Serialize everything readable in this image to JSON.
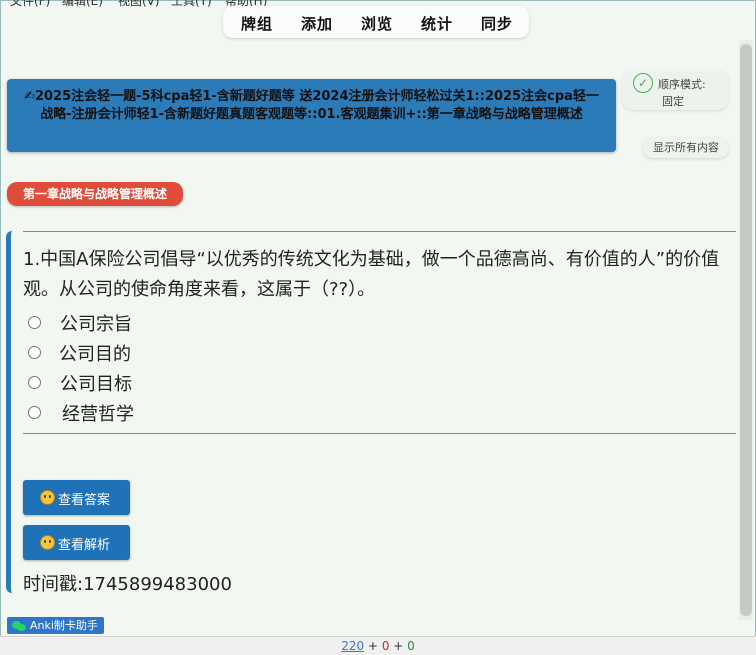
{
  "menubar": [
    "文件(F)",
    "编辑(E)",
    "视图(V)",
    "工具(T)",
    "帮助(H)"
  ],
  "toolbar": {
    "items": [
      "牌组",
      "添加",
      "浏览",
      "统计",
      "同步"
    ]
  },
  "deck": {
    "title": "✍2025注会轻一题-5科cpa轻1-含新题好题等 送2024注册会计师轻松过关1::2025注会cpa轻一战略-注册会计师轻1-含新题好题真题客观题等::01.客观题集训+::第一章战略与战略管理概述"
  },
  "order_mode": {
    "icon": "check-circle-icon",
    "label": "顺序模式:",
    "value": "固定"
  },
  "show_all": "显示所有内容",
  "chapter_tag": "第一章战略与战略管理概述",
  "question": {
    "text": "1.中国A保险公司倡导“以优秀的传统文化为基础，做一个品德高尚、有价值的人”的价值观。从公司的使命角度来看，这属于（??）。",
    "options": [
      "公司宗旨",
      "公司目的",
      "公司目标",
      "经营哲学"
    ]
  },
  "buttons": {
    "show_answer": "查看答案",
    "show_explanation": "查看解析"
  },
  "timestamp": "时间戳:1745899483000",
  "anki_badge": "Anki制卡助手",
  "status": {
    "new": "220",
    "learn": "0",
    "review": "0",
    "plus": "+"
  },
  "colors": {
    "accent": "#2b7bb9",
    "chapter_badge": "#e04c3a",
    "button": "#1f72b8",
    "new_count": "#3a79c6",
    "learn_count": "#c03030",
    "review_count": "#2e8b3c"
  }
}
